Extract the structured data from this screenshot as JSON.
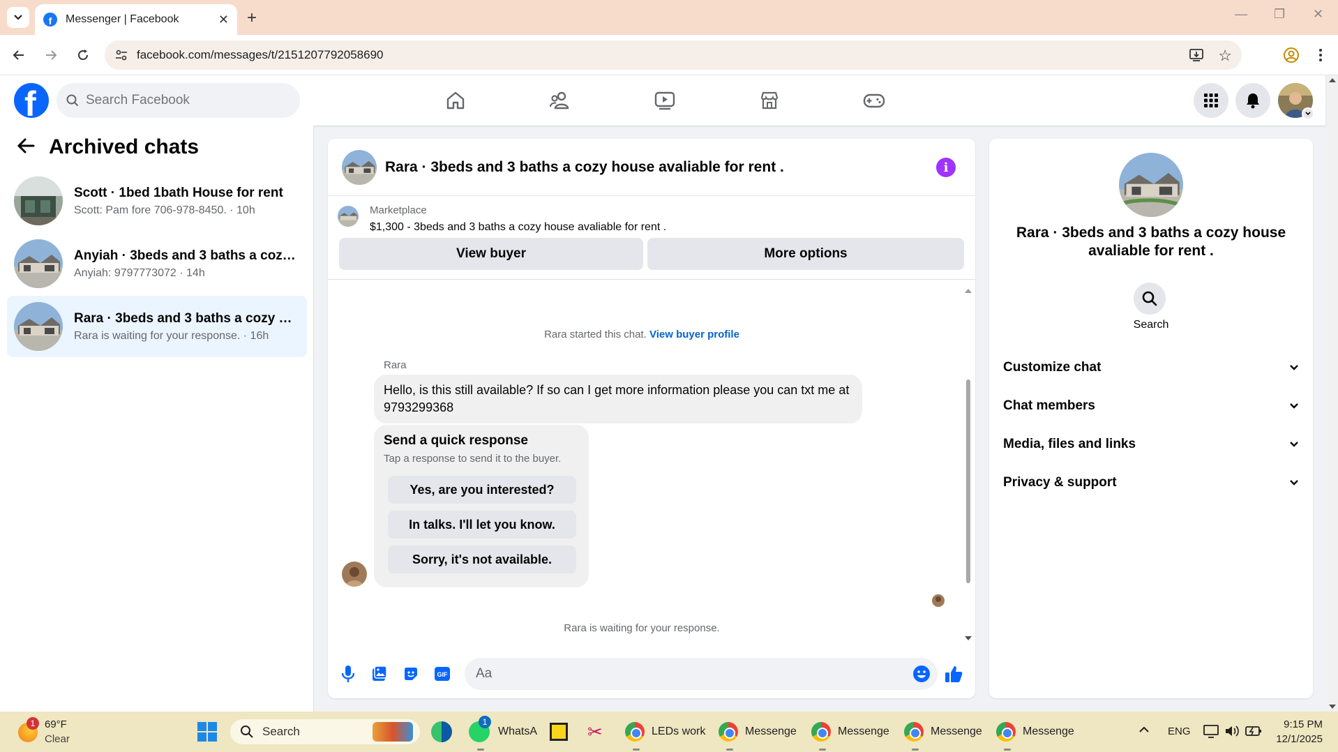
{
  "browser": {
    "tab_title": "Messenger | Facebook",
    "url": "facebook.com/messages/t/2151207792058690"
  },
  "fb": {
    "search_placeholder": "Search Facebook"
  },
  "left_panel": {
    "title": "Archived chats",
    "chats": [
      {
        "name": "Scott · 1bed 1bath House for rent",
        "preview": "Scott: Pam fore 706-978-8450. · 10h"
      },
      {
        "name": "Anyiah · 3beds and 3 baths a cozy house avaliable for rent .",
        "preview": "Anyiah: 9797773072 · 14h"
      },
      {
        "name": "Rara · 3beds and 3 baths a cozy house avaliable for rent .",
        "preview": "Rara is waiting for your response. · 16h"
      }
    ]
  },
  "conversation": {
    "title": "Rara · 3beds and 3 baths a cozy house avaliable for rent .",
    "marketplace_label": "Marketplace",
    "listing": "$1,300 - 3beds and 3 baths a cozy house avaliable for rent .",
    "view_buyer": "View buyer",
    "more_options": "More options",
    "started_text": "Rara started this chat.",
    "view_buyer_profile": "View buyer profile",
    "sender": "Rara",
    "message": "Hello, is this still available? If so can I get more information please you can txt me at 9793299368",
    "quick_response_title": "Send a quick response",
    "quick_response_sub": "Tap a response to send it to the buyer.",
    "quick_responses": [
      "Yes, are you interested?",
      "In talks. I'll let you know.",
      "Sorry, it's not available."
    ],
    "waiting_text": "Rara is waiting for your response.",
    "input_placeholder": "Aa"
  },
  "info_panel": {
    "name": "Rara · 3beds and 3 baths a cozy house avaliable for rent .",
    "search_label": "Search",
    "sections": [
      "Customize chat",
      "Chat members",
      "Media, files and links",
      "Privacy & support"
    ]
  },
  "taskbar": {
    "weather_temp": "69°F",
    "weather_desc": "Clear",
    "weather_badge": "1",
    "search_label": "Search",
    "apps": [
      "WhatsA",
      "LEDs work",
      "Messenge",
      "Messenge",
      "Messenge",
      "Messenge"
    ],
    "whatsapp_badge": "1",
    "lang": "ENG",
    "time": "9:15 PM",
    "date": "12/1/2025"
  },
  "colors": {
    "fb_blue": "#0866ff",
    "accent_purple": "#a033ff",
    "active_chat_bg": "#ebf5ff"
  }
}
